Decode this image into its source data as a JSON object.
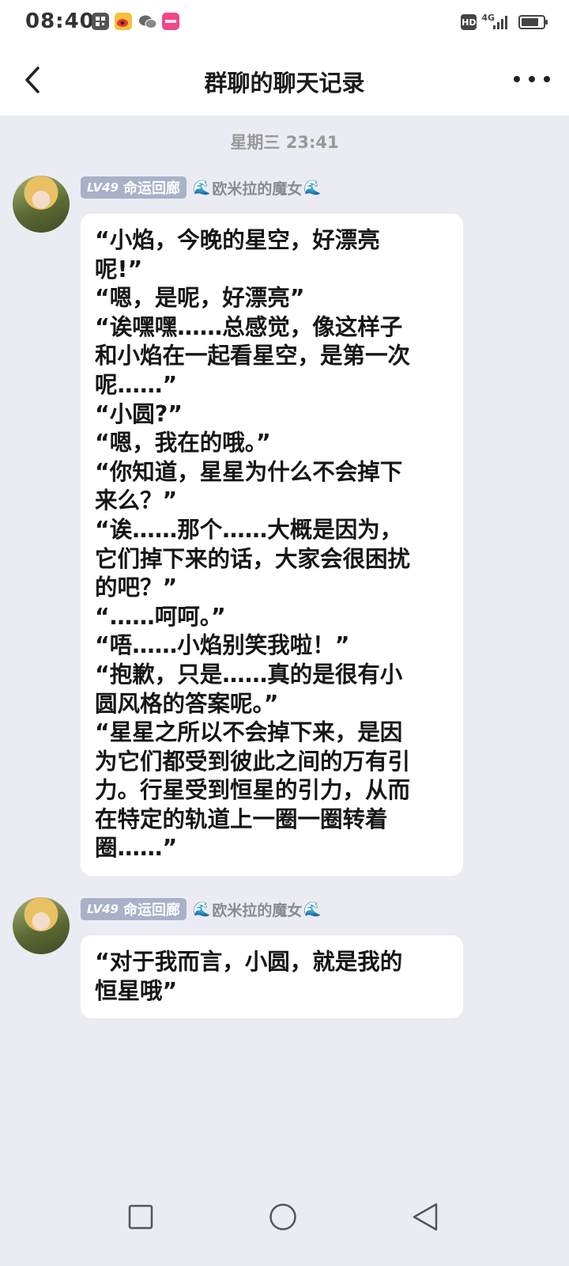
{
  "status_bar": {
    "time": "08:40",
    "icons": [
      "qr-app-icon",
      "weibo-icon",
      "wechat-icon",
      "pink-app-icon"
    ],
    "network": "4G",
    "hd": "HD"
  },
  "header": {
    "title": "群聊的聊天记录",
    "back_icon": "chevron-left-icon",
    "more_icon": "more-dots-icon"
  },
  "chat": {
    "timestamp": "星期三 23:41",
    "messages": [
      {
        "level": "LV49",
        "badge_title": "命运回廊",
        "sender_name": "欧米拉的魔女",
        "text": "“小焰，今晚的星空，好漂亮\n呢!”\n“嗯，是呢，好漂亮”\n“诶嘿嘿……总感觉，像这样子\n和小焰在一起看星空，是第一次\n呢……”\n“小圆?”\n“嗯，我在的哦。”\n“你知道，星星为什么不会掉下\n来么？”\n“诶……那个……大概是因为，\n它们掉下来的话，大家会很困扰\n的吧？”\n“……呵呵。”\n“唔……小焰别笑我啦！”\n“抱歉，只是……真的是很有小\n圆风格的答案呢。”\n“星星之所以不会掉下来，是因\n为它们都受到彼此之间的万有引\n力。行星受到恒星的引力，从而\n在特定的轨道上一圈一圈转着\n圈……”"
      },
      {
        "level": "LV49",
        "badge_title": "命运回廊",
        "sender_name": "欧米拉的魔女",
        "text": "“对于我而言，小圆，就是我的\n恒星哦”"
      }
    ]
  },
  "nav_bar": {
    "icons": [
      "recents-square-icon",
      "home-circle-icon",
      "back-triangle-icon"
    ]
  }
}
